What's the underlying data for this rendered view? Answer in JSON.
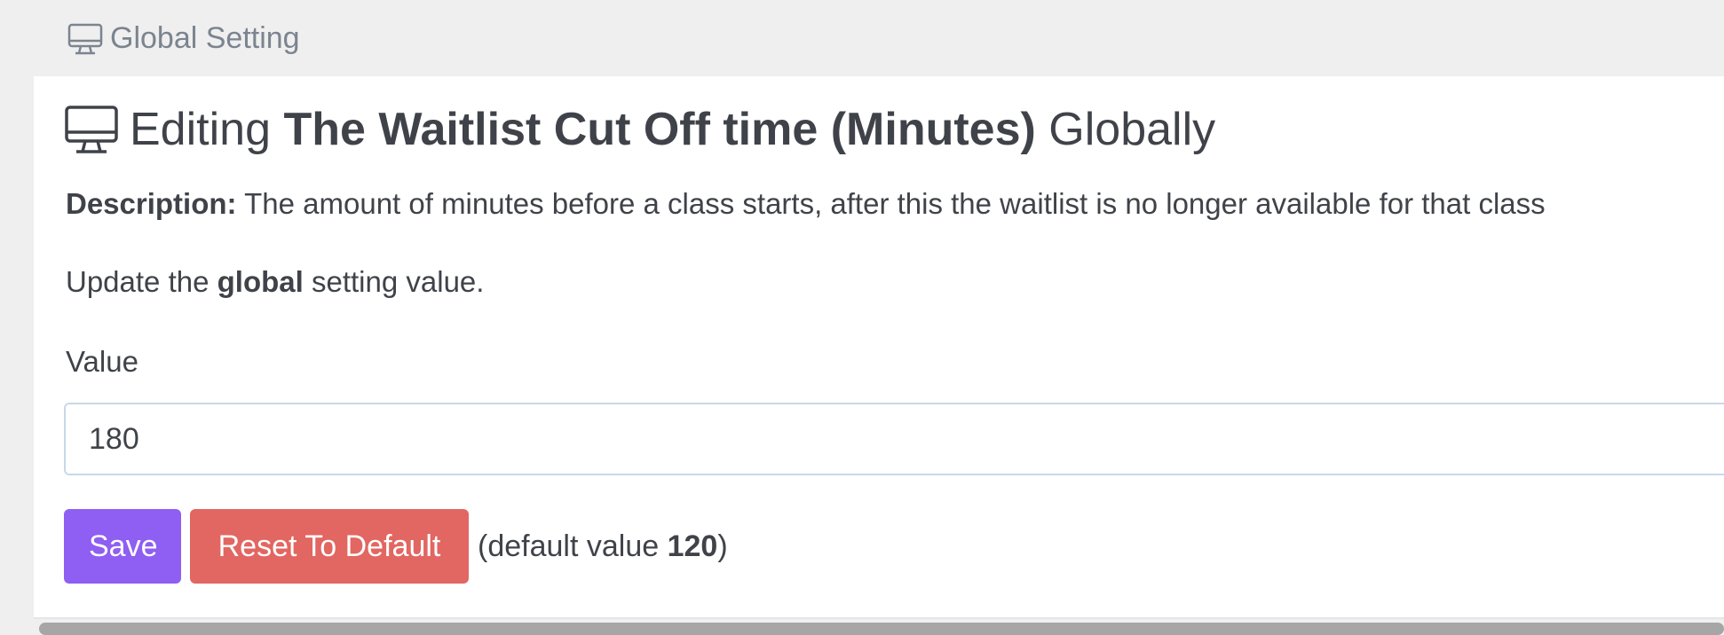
{
  "breadcrumb": {
    "label": "Global Setting",
    "icon": "monitor-icon"
  },
  "page": {
    "title_prefix": "Editing",
    "title_setting": "The Waitlist Cut Off time (Minutes)",
    "title_suffix": "Globally",
    "title_icon": "monitor-icon",
    "description_label": "Description:",
    "description_text": "The amount of minutes before a class starts, after this the waitlist is no longer available for that class",
    "update_prefix": "Update the",
    "update_bold": "global",
    "update_suffix": "setting value."
  },
  "form": {
    "value_label": "Value",
    "value": "180",
    "save_label": "Save",
    "reset_label": "Reset To Default",
    "default_prefix": "(default value",
    "default_value": "120",
    "default_suffix": ")"
  },
  "colors": {
    "save_button": "#8f5ef2",
    "reset_button": "#e26661",
    "page_background": "#efefef",
    "panel_background": "#ffffff"
  }
}
